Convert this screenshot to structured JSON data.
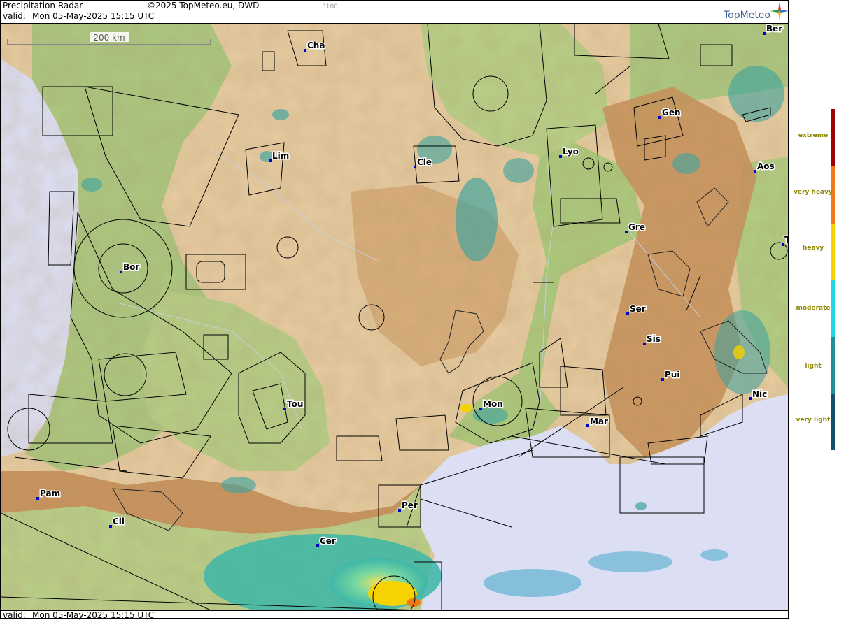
{
  "header": {
    "title": "Precipitation Radar",
    "copyright": "©2025 TopMeteo.eu, DWD",
    "valid_label": "valid:",
    "valid_time": "Mon  05-May-2025 15:15 UTC",
    "code": "3100"
  },
  "footer": {
    "valid_label": "valid:",
    "valid_time": "Mon  05-May-2025 15:15 UTC"
  },
  "scale_bar": {
    "label": "200 km"
  },
  "logo": {
    "text": "TopMeteo"
  },
  "legend": {
    "levels": [
      {
        "label": "extreme",
        "color": "#a00000"
      },
      {
        "label": "very heavy",
        "color": "#f07a14"
      },
      {
        "label": "heavy",
        "color": "#f5d200"
      },
      {
        "label": "moderate",
        "color": "#22d8e0"
      },
      {
        "label": "light",
        "color": "#208f9a"
      },
      {
        "label": "very light",
        "color": "#14506e"
      }
    ]
  },
  "cities": [
    {
      "name": "Cha"
    },
    {
      "name": "Ber"
    },
    {
      "name": "Gen"
    },
    {
      "name": "Lim"
    },
    {
      "name": "Cle"
    },
    {
      "name": "Lyo"
    },
    {
      "name": "Aos"
    },
    {
      "name": "Gre"
    },
    {
      "name": "Bor"
    },
    {
      "name": "Ser"
    },
    {
      "name": "Sis"
    },
    {
      "name": "Pui"
    },
    {
      "name": "Tou"
    },
    {
      "name": "Mon"
    },
    {
      "name": "Mar"
    },
    {
      "name": "Nic"
    },
    {
      "name": "Pam"
    },
    {
      "name": "Cil"
    },
    {
      "name": "Per"
    },
    {
      "name": "Cer"
    },
    {
      "name": "Tu"
    }
  ],
  "colors": {
    "sea": "#dcdff4",
    "lowland": "#a7c77e",
    "terrain": "#e6cba0",
    "mountain": "#c8935a",
    "city_marker": "#0000cc"
  }
}
